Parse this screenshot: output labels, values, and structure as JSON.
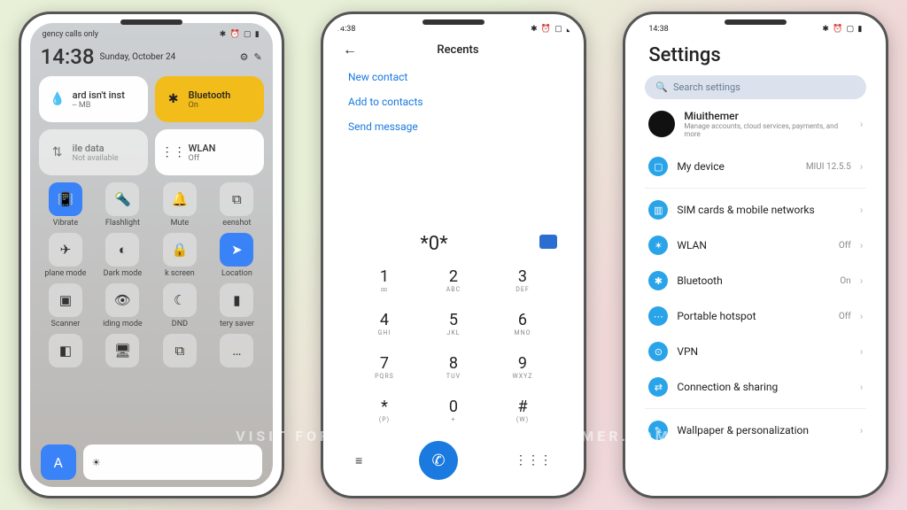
{
  "watermark": "VISIT FOR MORE THEMES - MIUITHEMER.COM",
  "status": {
    "carrier": "gency calls only",
    "time": "14:38",
    "icons": "✱ ⏰ ▢ ▮"
  },
  "cc": {
    "time": "14:38",
    "date": "Sunday, October 24",
    "tiles": [
      {
        "icon": "💧",
        "title": "ard isn't inst",
        "sub": "-- MB"
      },
      {
        "icon": "✱",
        "title": "Bluetooth",
        "sub": "On"
      },
      {
        "icon": "⇅",
        "title": "ile data",
        "sub": "Not available"
      },
      {
        "icon": "⋮⋮",
        "title": "WLAN",
        "sub": "Off"
      }
    ],
    "qs": [
      {
        "label": "Vibrate",
        "icon": "📳",
        "on": true
      },
      {
        "label": "Flashlight",
        "icon": "🔦",
        "on": false
      },
      {
        "label": "Mute",
        "icon": "🔔",
        "on": false
      },
      {
        "label": "eenshot",
        "icon": "⧉",
        "on": false
      },
      {
        "label": "plane mode",
        "icon": "✈",
        "on": false
      },
      {
        "label": "Dark mode",
        "icon": "◐",
        "on": false
      },
      {
        "label": "k screen",
        "icon": "🔒",
        "on": false
      },
      {
        "label": "Location",
        "icon": "➤",
        "on": true
      },
      {
        "label": "Scanner",
        "icon": "▣",
        "on": false
      },
      {
        "label": "iding mode",
        "icon": "👁",
        "on": false
      },
      {
        "label": "DND",
        "icon": "☾",
        "on": false
      },
      {
        "label": "tery saver",
        "icon": "▮",
        "on": false
      },
      {
        "label": "",
        "icon": "◧",
        "on": false
      },
      {
        "label": "",
        "icon": "🖥",
        "on": false
      },
      {
        "label": "",
        "icon": "⧉",
        "on": false
      },
      {
        "label": "",
        "icon": "…",
        "on": false
      }
    ],
    "brightness_icon": "☀",
    "font_icon": "A"
  },
  "dial": {
    "title": "Recents",
    "links": [
      "New contact",
      "Add to contacts",
      "Send message"
    ],
    "number": "*0*",
    "keys": [
      {
        "n": "1",
        "l": "∞"
      },
      {
        "n": "2",
        "l": "ABC"
      },
      {
        "n": "3",
        "l": "DEF"
      },
      {
        "n": "4",
        "l": "GHI"
      },
      {
        "n": "5",
        "l": "JKL"
      },
      {
        "n": "6",
        "l": "MNO"
      },
      {
        "n": "7",
        "l": "PQRS"
      },
      {
        "n": "8",
        "l": "TUV"
      },
      {
        "n": "9",
        "l": "WXYZ"
      },
      {
        "n": "*",
        "l": "(P)"
      },
      {
        "n": "0",
        "l": "+"
      },
      {
        "n": "#",
        "l": "(W)"
      }
    ]
  },
  "settings": {
    "title": "Settings",
    "search_placeholder": "Search settings",
    "account": {
      "name": "Miuithemer",
      "sub": "Manage accounts, cloud services, payments, and more"
    },
    "rows": [
      {
        "icon": "▢",
        "label": "My device",
        "value": "MIUI 12.5.5"
      },
      {
        "icon": "▥",
        "label": "SIM cards & mobile networks",
        "value": ""
      },
      {
        "icon": "✶",
        "label": "WLAN",
        "value": "Off"
      },
      {
        "icon": "✱",
        "label": "Bluetooth",
        "value": "On"
      },
      {
        "icon": "⋯",
        "label": "Portable hotspot",
        "value": "Off"
      },
      {
        "icon": "⊙",
        "label": "VPN",
        "value": ""
      },
      {
        "icon": "⇄",
        "label": "Connection & sharing",
        "value": ""
      },
      {
        "icon": "✎",
        "label": "Wallpaper & personalization",
        "value": ""
      }
    ]
  }
}
